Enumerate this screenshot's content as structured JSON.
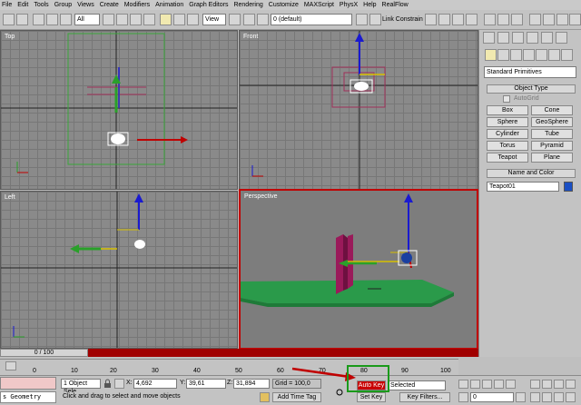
{
  "menu": [
    "File",
    "Edit",
    "Tools",
    "Group",
    "Views",
    "Create",
    "Modifiers",
    "Animation",
    "Graph Editors",
    "Rendering",
    "Customize",
    "MAXScript",
    "PhysX",
    "Help",
    "RealFlow"
  ],
  "toolbar": {
    "selection_filter": "All",
    "named_selection": "0 (default)",
    "link_constraint": "Link Constrain",
    "view_dropdown": "View"
  },
  "viewports": {
    "top": "Top",
    "front": "Front",
    "left": "Left",
    "perspective": "Perspective"
  },
  "command_panel": {
    "category": "Standard Primitives",
    "object_type_header": "Object Type",
    "autogrid": "AutoGrid",
    "buttons": [
      "Box",
      "Cone",
      "Sphere",
      "GeoSphere",
      "Cylinder",
      "Tube",
      "Torus",
      "Pyramid",
      "Teapot",
      "Plane"
    ],
    "name_color_header": "Name and Color",
    "object_name": "Teapot01",
    "object_color": "#1a4fc4"
  },
  "timeline": {
    "frame_display": "0 / 100",
    "ticks": [
      "0",
      "10",
      "20",
      "30",
      "40",
      "50",
      "60",
      "70",
      "80",
      "90",
      "100"
    ]
  },
  "status": {
    "script_listener": "s Geometry",
    "selection_count": "1 Object Sele",
    "x_label": "X:",
    "x": "4,692",
    "y_label": "Y:",
    "y": "39,61",
    "z_label": "Z:",
    "z": "31,894",
    "grid": "Grid = 100,0",
    "prompt": "Click and drag to select and move objects",
    "add_time_tag": "Add Time Tag",
    "auto_key": "Auto Key",
    "set_key": "Set Key",
    "key_mode": "Selected",
    "key_filters": "Key Filters...",
    "current_frame": "0"
  }
}
